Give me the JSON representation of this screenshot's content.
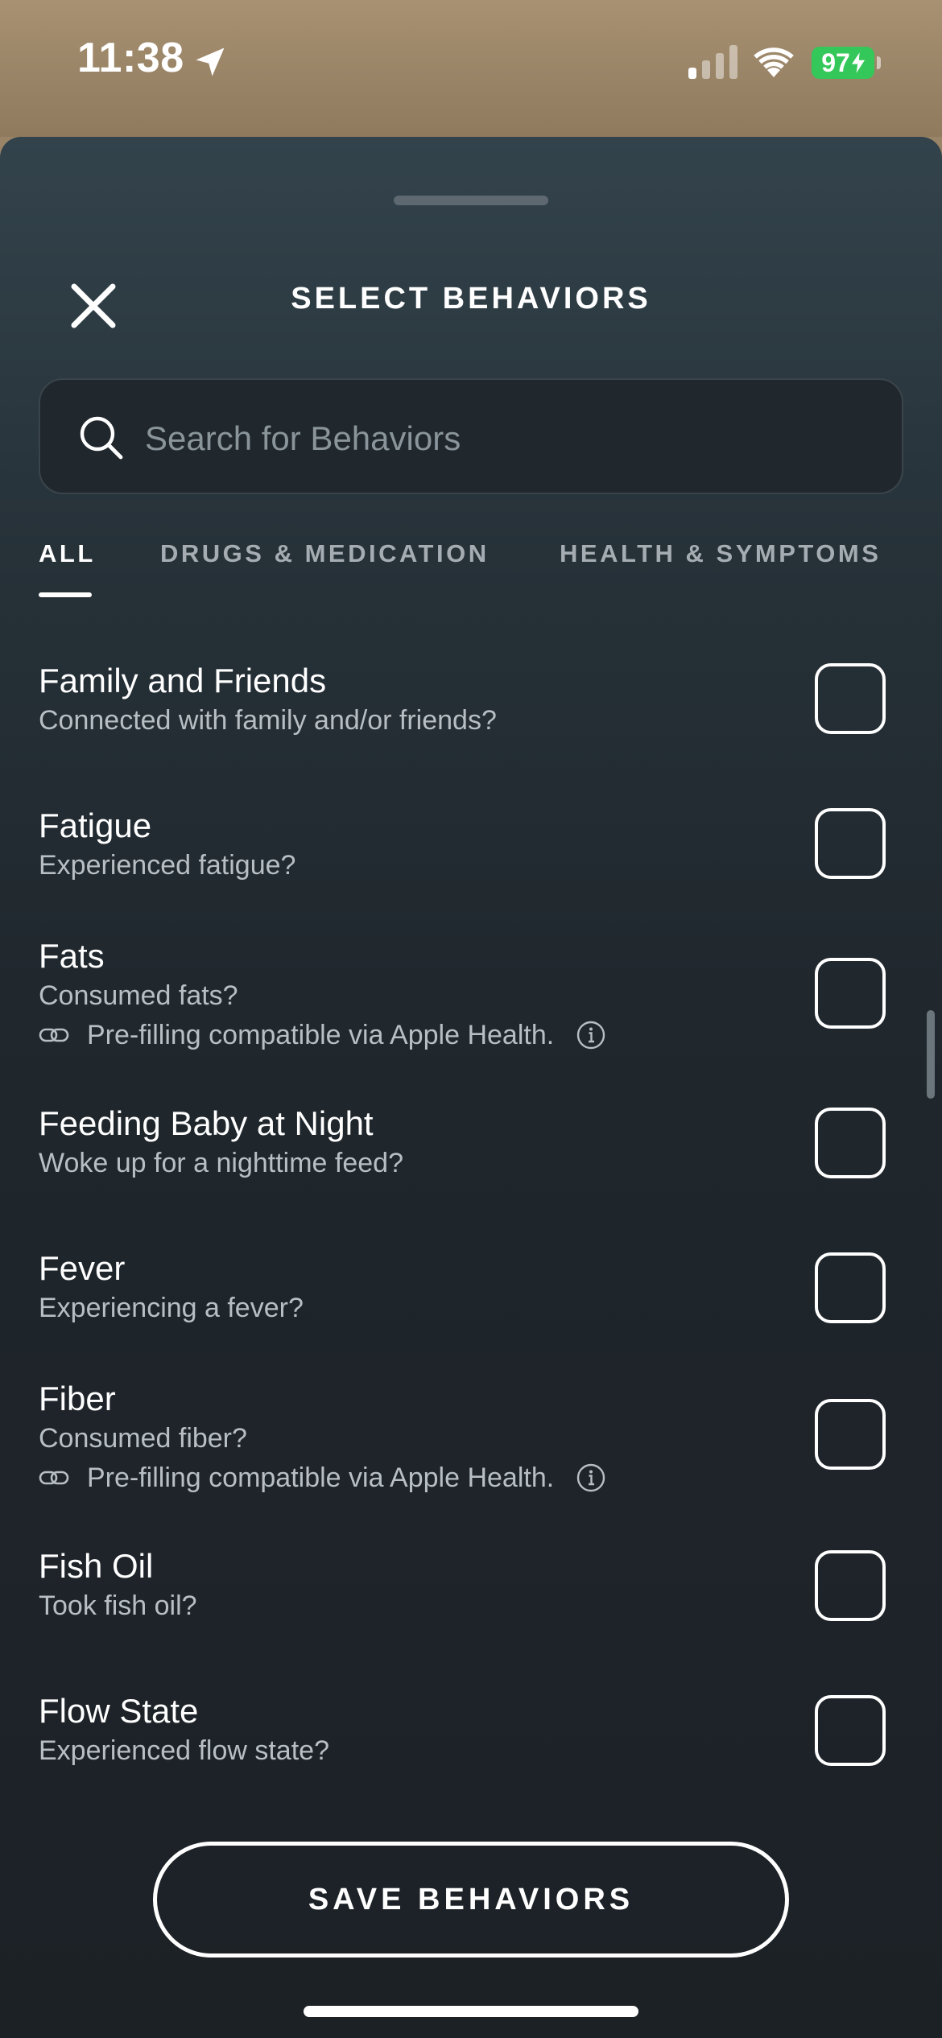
{
  "status_bar": {
    "time": "11:38",
    "battery": "97",
    "battery_color": "#34c759"
  },
  "header": {
    "title": "SELECT BEHAVIORS",
    "close_icon": "close-icon"
  },
  "search": {
    "placeholder": "Search for Behaviors",
    "value": ""
  },
  "tabs": [
    {
      "label": "ALL",
      "active": true
    },
    {
      "label": "DRUGS & MEDICATION",
      "active": false
    },
    {
      "label": "HEALTH & SYMPTOMS",
      "active": false
    }
  ],
  "behaviors": [
    {
      "title": "Family and Friends",
      "subtitle": "Connected with family and/or friends?",
      "checked": false
    },
    {
      "title": "Fatigue",
      "subtitle": "Experienced fatigue?",
      "checked": false
    },
    {
      "title": "Fats",
      "subtitle": "Consumed fats?",
      "prefill": "Pre-filling compatible via Apple Health.",
      "checked": false
    },
    {
      "title": "Feeding Baby at Night",
      "subtitle": "Woke up for a nighttime feed?",
      "checked": false
    },
    {
      "title": "Fever",
      "subtitle": "Experiencing a fever?",
      "checked": false
    },
    {
      "title": "Fiber",
      "subtitle": "Consumed fiber?",
      "prefill": "Pre-filling compatible via Apple Health.",
      "checked": false
    },
    {
      "title": "Fish Oil",
      "subtitle": "Took fish oil?",
      "checked": false
    },
    {
      "title": "Flow State",
      "subtitle": "Experienced flow state?",
      "checked": false
    }
  ],
  "footer": {
    "save_label": "SAVE BEHAVIORS"
  }
}
